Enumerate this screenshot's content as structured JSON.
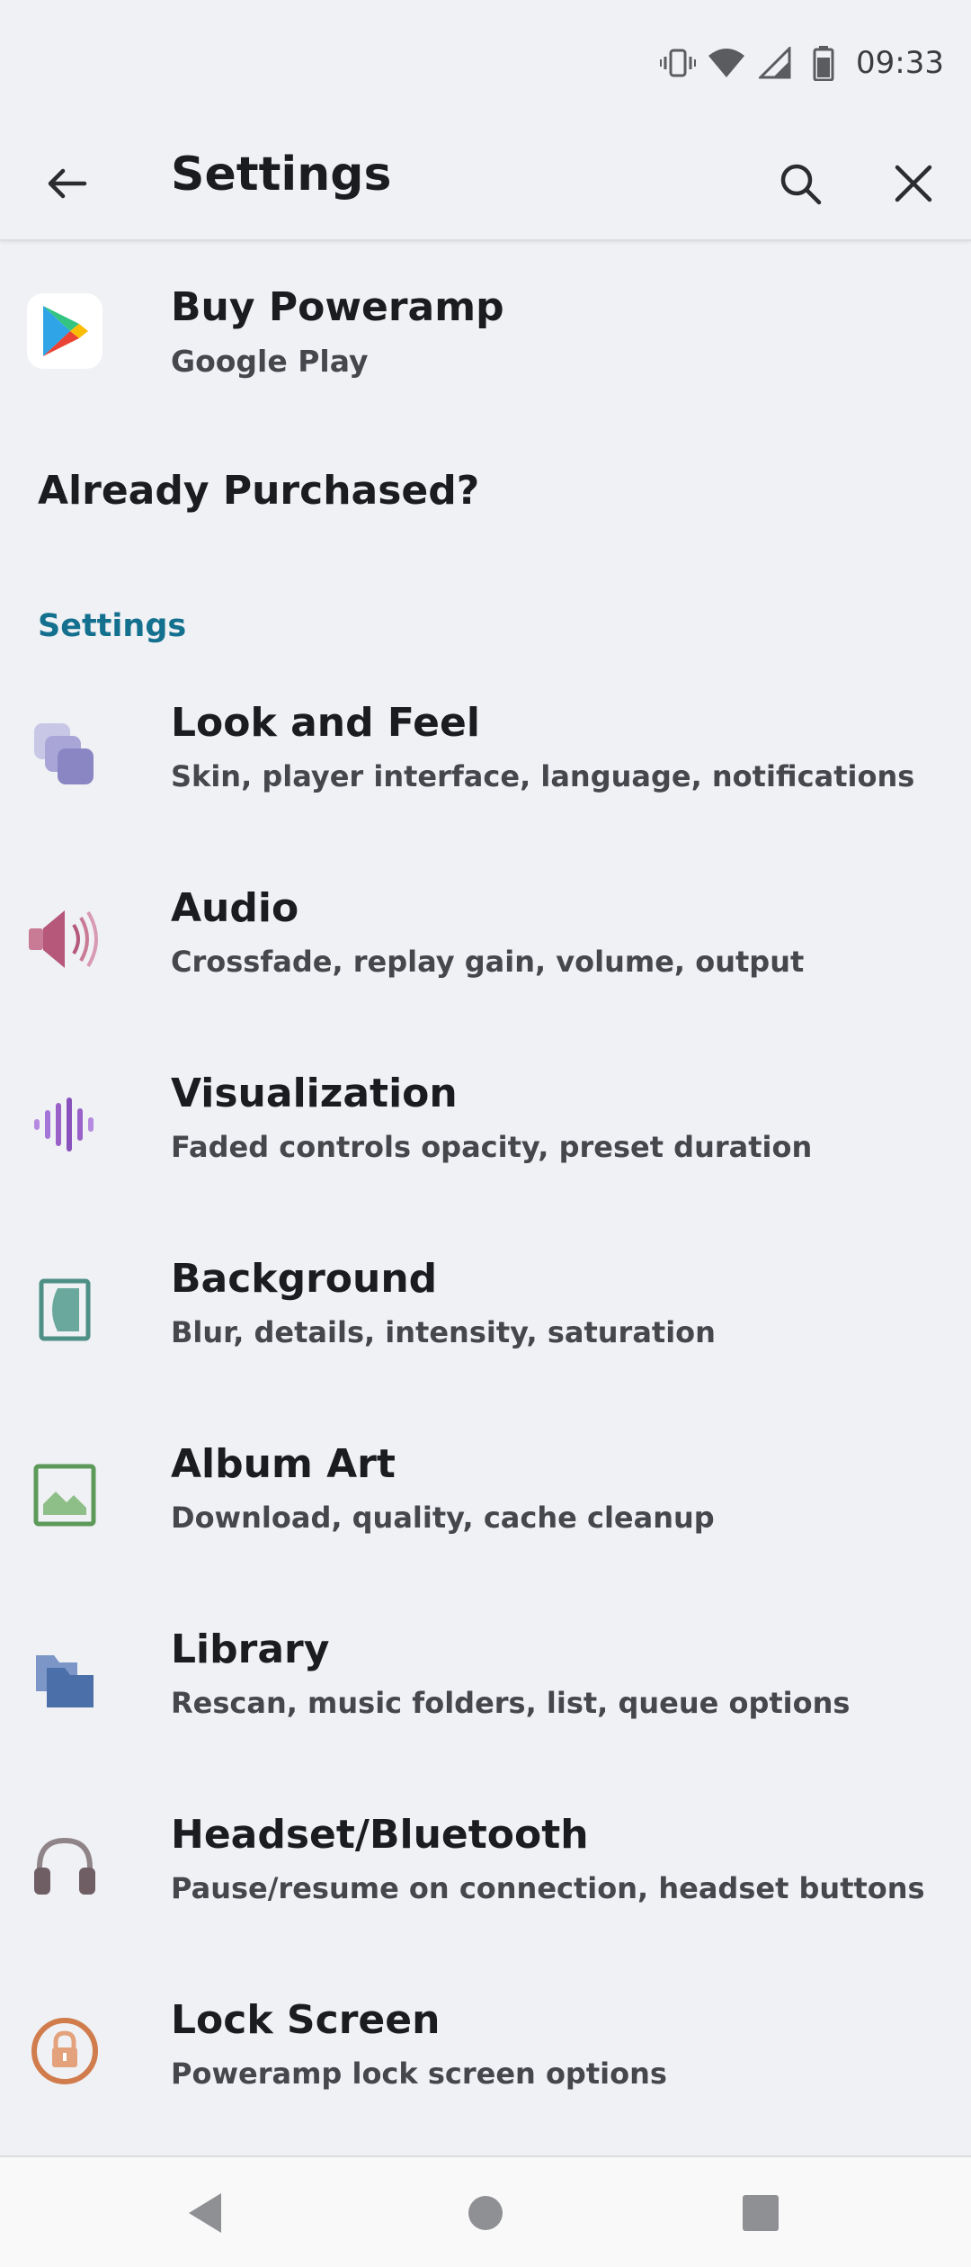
{
  "status_bar": {
    "time": "09:33",
    "icons": [
      "vibrate-icon",
      "wifi-icon",
      "signal-icon",
      "battery-icon"
    ]
  },
  "app_bar": {
    "title": "Settings",
    "icons": [
      "back-arrow-icon",
      "search-icon",
      "close-icon"
    ]
  },
  "buy": {
    "title": "Buy Poweramp",
    "subtitle": "Google Play",
    "icon": "google-play-icon"
  },
  "already_purchased": "Already Purchased?",
  "section_header": "Settings",
  "items": [
    {
      "title": "Look and Feel",
      "subtitle": "Skin, player interface, language, notifications",
      "icon": "look-and-feel-icon",
      "color": "#8a86c4"
    },
    {
      "title": "Audio",
      "subtitle": "Crossfade, replay gain, volume, output",
      "icon": "speaker-icon",
      "color": "#b5587a"
    },
    {
      "title": "Visualization",
      "subtitle": "Faded controls opacity, preset duration",
      "icon": "waveform-icon",
      "color": "#9a62c9"
    },
    {
      "title": "Background",
      "subtitle": "Blur, details, intensity, saturation",
      "icon": "background-icon",
      "color": "#4e8f86"
    },
    {
      "title": "Album Art",
      "subtitle": "Download, quality, cache cleanup",
      "icon": "image-icon",
      "color": "#5d9a5a"
    },
    {
      "title": "Library",
      "subtitle": "Rescan, music folders, list, queue options",
      "icon": "folder-icon",
      "color": "#4b6fa8"
    },
    {
      "title": "Headset/Bluetooth",
      "subtitle": "Pause/resume on connection, headset buttons",
      "icon": "headphones-icon",
      "color": "#7c6b70"
    },
    {
      "title": "Lock Screen",
      "subtitle": "Poweramp lock screen options",
      "icon": "lock-icon",
      "color": "#d07c4c"
    }
  ],
  "nav_bar": {
    "icons": [
      "nav-back-icon",
      "nav-home-icon",
      "nav-recents-icon"
    ]
  }
}
